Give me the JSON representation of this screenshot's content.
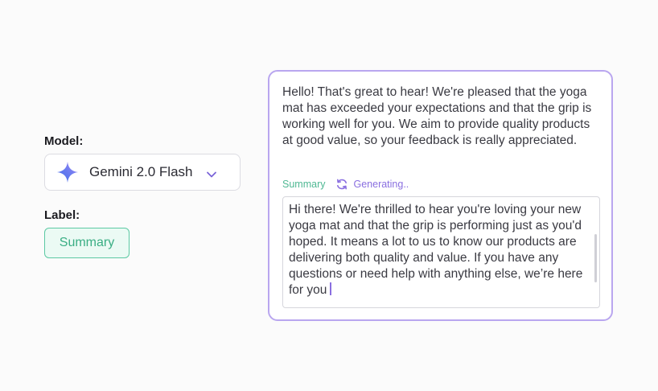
{
  "model_section": {
    "label": "Model:",
    "selected_model": "Gemini 2.0 Flash",
    "model_icon": "gemini-sparkle-icon",
    "dropdown_icon": "chevron-down-icon"
  },
  "label_section": {
    "label": "Label:",
    "badge": "Summary"
  },
  "card": {
    "message": "Hello! That's great to hear! We're pleased that the yoga mat has exceeded your expectations and that the grip is working well for you. We aim to provide quality products at good value, so your feedback is really appreciated.",
    "status": {
      "label": "Summary",
      "icon": "refresh-icon",
      "generating_text": "Generating.."
    },
    "response": "Hi there! We're thrilled to hear you're loving your new yoga mat and that the grip is performing just as you'd hoped. It means a lot to us to know our products are delivering both quality and value. If you have any questions or need help with anything else, we’re here for you"
  },
  "colors": {
    "accent_purple": "#8a6fe0",
    "card_border": "#b9a6ef",
    "badge_green": "#3aae84",
    "badge_bg": "#ebfaf4"
  }
}
